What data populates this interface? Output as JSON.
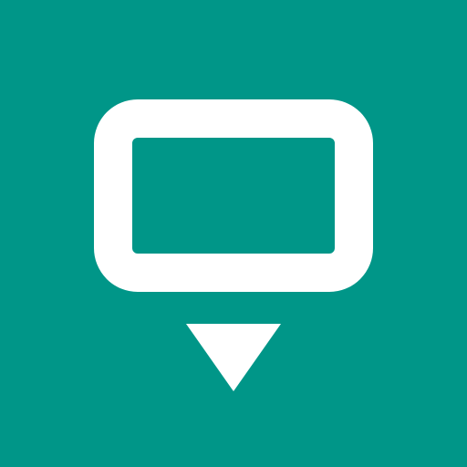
{
  "icon": {
    "name": "pin-marker-icon",
    "background_color": "#009688",
    "foreground_color": "#ffffff",
    "parts": [
      "rounded-rectangle-frame",
      "downward-triangle-pointer"
    ]
  }
}
